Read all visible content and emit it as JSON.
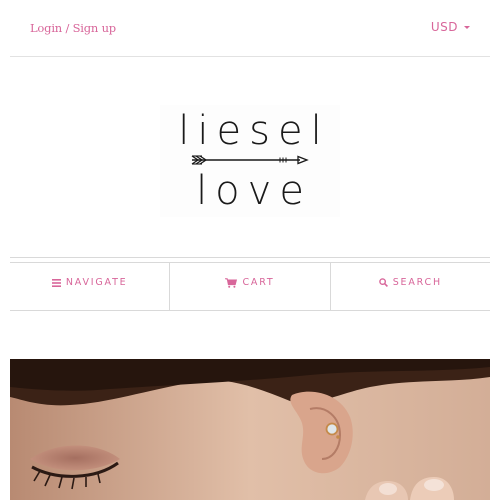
{
  "header": {
    "login_label": "Login / Sign up",
    "currency": "USD",
    "currency_caret_icon": "caret-down-icon"
  },
  "logo": {
    "line1": "liesel",
    "line2": "love",
    "arrow_icon": "arrow-ornament-icon"
  },
  "nav": {
    "items": [
      {
        "label": "NAVIGATE",
        "icon": "hamburger-icon"
      },
      {
        "label": "CART",
        "icon": "cart-icon"
      },
      {
        "label": "SEARCH",
        "icon": "search-icon"
      }
    ]
  },
  "hero": {
    "image": "photo of a woman's ear wearing a small opal stud earring"
  },
  "colors": {
    "accent": "#d8669a",
    "divider": "#d9d9d9",
    "logo_text": "#1a1a1a"
  }
}
